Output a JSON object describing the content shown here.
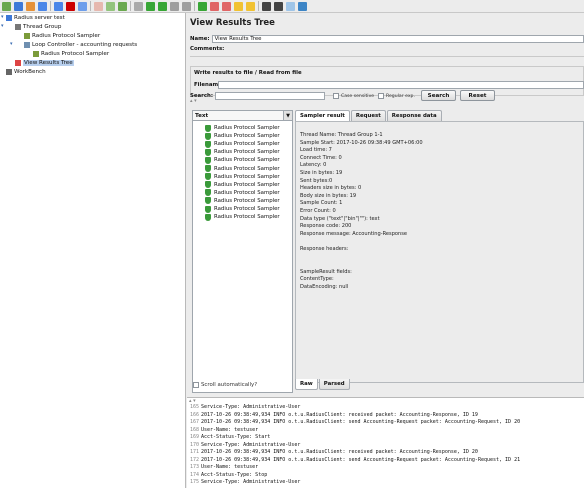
{
  "toolbar": {
    "icons": [
      "new-icon",
      "templates-icon",
      "open-icon",
      "save-icon",
      "save-as-icon",
      "cut-icon",
      "copy-icon",
      "paste-icon",
      "expand-icon",
      "collapse-icon",
      "toggle-icon",
      "start-icon",
      "start-no-pause-icon",
      "stop-icon",
      "shutdown-icon",
      "remote-start-icon",
      "remote-stop-icon",
      "remote-exit-icon",
      "clear-icon",
      "clear-all-icon",
      "search-icon",
      "reset-search-icon",
      "function-helper-icon",
      "help-icon"
    ],
    "colors": [
      "#6aa84f",
      "#3c78d8",
      "#e69138",
      "#4a86e8",
      "#4a86e8",
      "#cc0000",
      "#6d9eeb",
      "#e6b8af",
      "#93c47d",
      "#6aa84f",
      "#aaaaaa",
      "#38a636",
      "#38a636",
      "#9e9e9e",
      "#9e9e9e",
      "#38a636",
      "#e06666",
      "#e06666",
      "#f1c232",
      "#f1c232",
      "#444444",
      "#444444",
      "#9fc5e8",
      "#3d85c6"
    ]
  },
  "tree": {
    "nodes": [
      {
        "label": "Radius server test",
        "indent": 0,
        "icon_color": "#3c78d8",
        "selected": false
      },
      {
        "label": "Thread Group",
        "indent": 1,
        "icon_color": "#777777",
        "selected": false
      },
      {
        "label": "Radius Protocol Sampler",
        "indent": 2,
        "icon_color": "#7b9b3a",
        "selected": false
      },
      {
        "label": "Loop Controller - accounting requests",
        "indent": 2,
        "icon_color": "#6f8fb0",
        "selected": false
      },
      {
        "label": "Radius Protocol Sampler",
        "indent": 3,
        "icon_color": "#7b9b3a",
        "selected": false
      },
      {
        "label": "View Results Tree",
        "indent": 1,
        "icon_color": "#d44",
        "selected": true
      },
      {
        "label": "WorkBench",
        "indent": 0,
        "icon_color": "#666666",
        "selected": false
      }
    ]
  },
  "panel": {
    "title": "View Results Tree",
    "name_label": "Name:",
    "name_value": "View Results Tree",
    "comments_label": "Comments:",
    "file_section": "Write results to file / Read from file",
    "filename_label": "Filename",
    "search_label": "Search:",
    "case_sensitive": "Case sensitive",
    "regular_exp": "Regular exp.",
    "search_button": "Search",
    "reset_button": "Reset",
    "renderer": "Text",
    "scroll_auto": "Scroll automatically?",
    "samples": [
      "Radius Protocol Sampler",
      "Radius Protocol Sampler",
      "Radius Protocol Sampler",
      "Radius Protocol Sampler",
      "Radius Protocol Sampler",
      "Radius Protocol Sampler",
      "Radius Protocol Sampler",
      "Radius Protocol Sampler",
      "Radius Protocol Sampler",
      "Radius Protocol Sampler",
      "Radius Protocol Sampler",
      "Radius Protocol Sampler"
    ],
    "tabs": [
      "Sampler result",
      "Request",
      "Response data"
    ],
    "bottom_tabs": [
      "Raw",
      "Parsed"
    ],
    "result_lines": [
      "Thread Name: Thread Group 1-1",
      "Sample Start: 2017-10-26 09:38:49 GMT+06:00",
      "Load time: 7",
      "Connect Time: 0",
      "Latency: 0",
      "Size in bytes: 19",
      "Sent bytes:0",
      "Headers size in bytes: 0",
      "Body size in bytes: 19",
      "Sample Count: 1",
      "Error Count: 0",
      "Data type (\"text\"|\"bin\"|\"\"): text",
      "Response code: 200",
      "Response message: Accounting-Response",
      "",
      "Response headers:",
      "",
      "",
      "SampleResult fields:",
      "ContentType:",
      "DataEncoding: null"
    ]
  },
  "log": {
    "lines": [
      {
        "n": "165",
        "t": "Service-Type: Administrative-User"
      },
      {
        "n": "166",
        "t": "2017-10-26 09:38:49,934 INFO o.t.u.RadiusClient: received packet: Accounting-Response, ID 19"
      },
      {
        "n": "167",
        "t": "2017-10-26 09:38:49,934 INFO o.t.u.RadiusClient: send Accounting-Request packet: Accounting-Request, ID 20"
      },
      {
        "n": "168",
        "t": "User-Name: testuser"
      },
      {
        "n": "169",
        "t": "Acct-Status-Type: Start"
      },
      {
        "n": "170",
        "t": "Service-Type: Administrative-User"
      },
      {
        "n": "171",
        "t": "2017-10-26 09:38:49,934 INFO o.t.u.RadiusClient: received packet: Accounting-Response, ID 20"
      },
      {
        "n": "172",
        "t": "2017-10-26 09:38:49,934 INFO o.t.u.RadiusClient: send Accounting-Request packet: Accounting-Request, ID 21"
      },
      {
        "n": "173",
        "t": "User-Name: testuser"
      },
      {
        "n": "174",
        "t": "Acct-Status-Type: Stop"
      },
      {
        "n": "175",
        "t": "Service-Type: Administrative-User"
      }
    ]
  }
}
